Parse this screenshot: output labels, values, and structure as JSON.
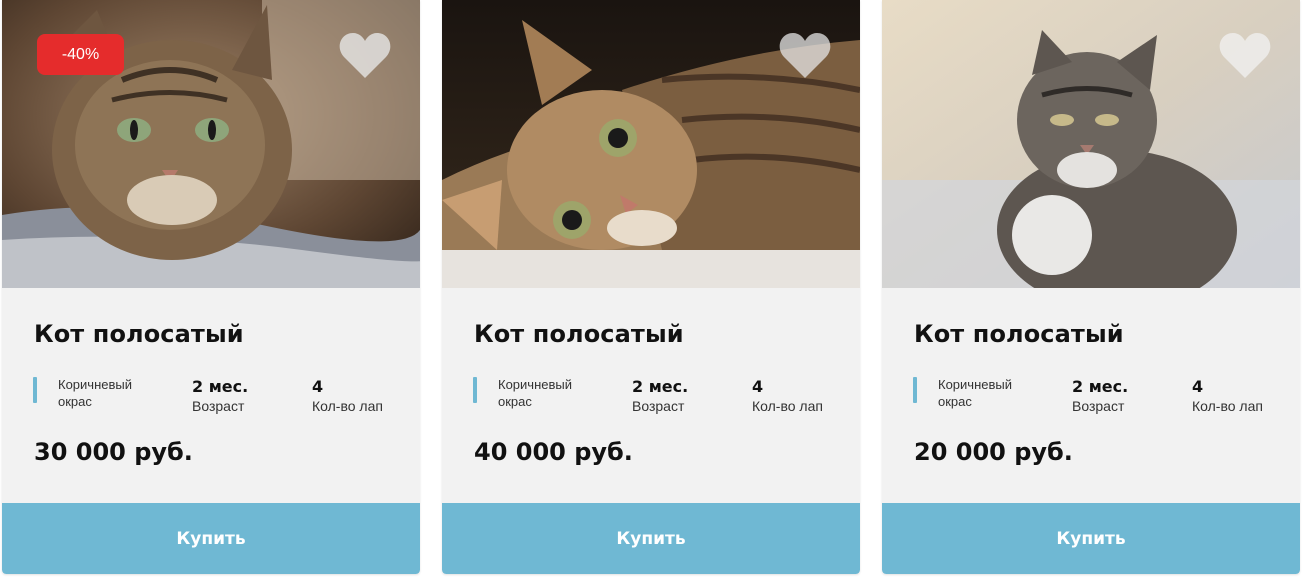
{
  "cards": [
    {
      "badge": "-40%",
      "title": "Кот полосатый",
      "color_text": "Коричневый окрас",
      "age_value": "2 мес.",
      "age_label": "Возраст",
      "paws_value": "4",
      "paws_label": "Кол-во лап",
      "price": "30 000 руб.",
      "buy_label": "Купить",
      "favorite_icon": "heart-icon"
    },
    {
      "title": "Кот полосатый",
      "color_text": "Коричневый окрас",
      "age_value": "2 мес.",
      "age_label": "Возраст",
      "paws_value": "4",
      "paws_label": "Кол-во лап",
      "price": "40 000 руб.",
      "buy_label": "Купить",
      "favorite_icon": "heart-icon"
    },
    {
      "title": "Кот полосатый",
      "color_text": "Коричневый окрас",
      "age_value": "2 мес.",
      "age_label": "Возраст",
      "paws_value": "4",
      "paws_label": "Кол-во лап",
      "price": "20 000 руб.",
      "buy_label": "Купить",
      "favorite_icon": "heart-icon"
    }
  ],
  "colors": {
    "accent": "#6fb8d3",
    "badge": "#e52c2c",
    "card_bg": "#f2f2f2"
  }
}
